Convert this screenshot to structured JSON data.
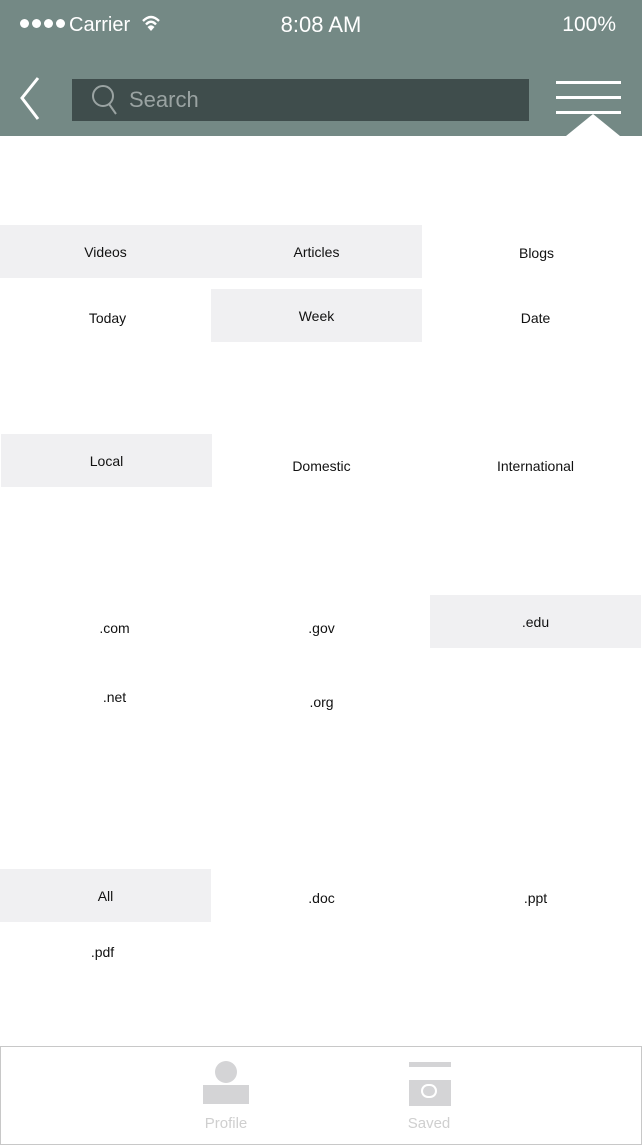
{
  "status_bar": {
    "carrier": "Carrier",
    "time": "8:08 AM",
    "battery": "100%"
  },
  "search": {
    "placeholder": "Search"
  },
  "filters": {
    "content_type": [
      {
        "label": "Videos",
        "selected": true
      },
      {
        "label": "Articles",
        "selected": true
      },
      {
        "label": "Blogs",
        "selected": false
      }
    ],
    "time_range": [
      {
        "label": "Today",
        "selected": false
      },
      {
        "label": "Week",
        "selected": true
      },
      {
        "label": "Date",
        "selected": false
      }
    ],
    "region": [
      {
        "label": "Local",
        "selected": true
      },
      {
        "label": "Domestic",
        "selected": false
      },
      {
        "label": "International",
        "selected": false
      }
    ],
    "domain": [
      {
        "label": ".com",
        "selected": false
      },
      {
        "label": ".gov",
        "selected": false
      },
      {
        "label": ".edu",
        "selected": true
      },
      {
        "label": ".net",
        "selected": false
      },
      {
        "label": ".org",
        "selected": false
      }
    ],
    "file_type": [
      {
        "label": "All",
        "selected": true
      },
      {
        "label": ".doc",
        "selected": false
      },
      {
        "label": ".ppt",
        "selected": false
      },
      {
        "label": ".pdf",
        "selected": false
      }
    ]
  },
  "tabbar": {
    "profile": "Profile",
    "saved": "Saved"
  },
  "colors": {
    "header": "#748985",
    "search_bg": "#3f4d4c",
    "selected_bg": "#f0f0f2"
  }
}
